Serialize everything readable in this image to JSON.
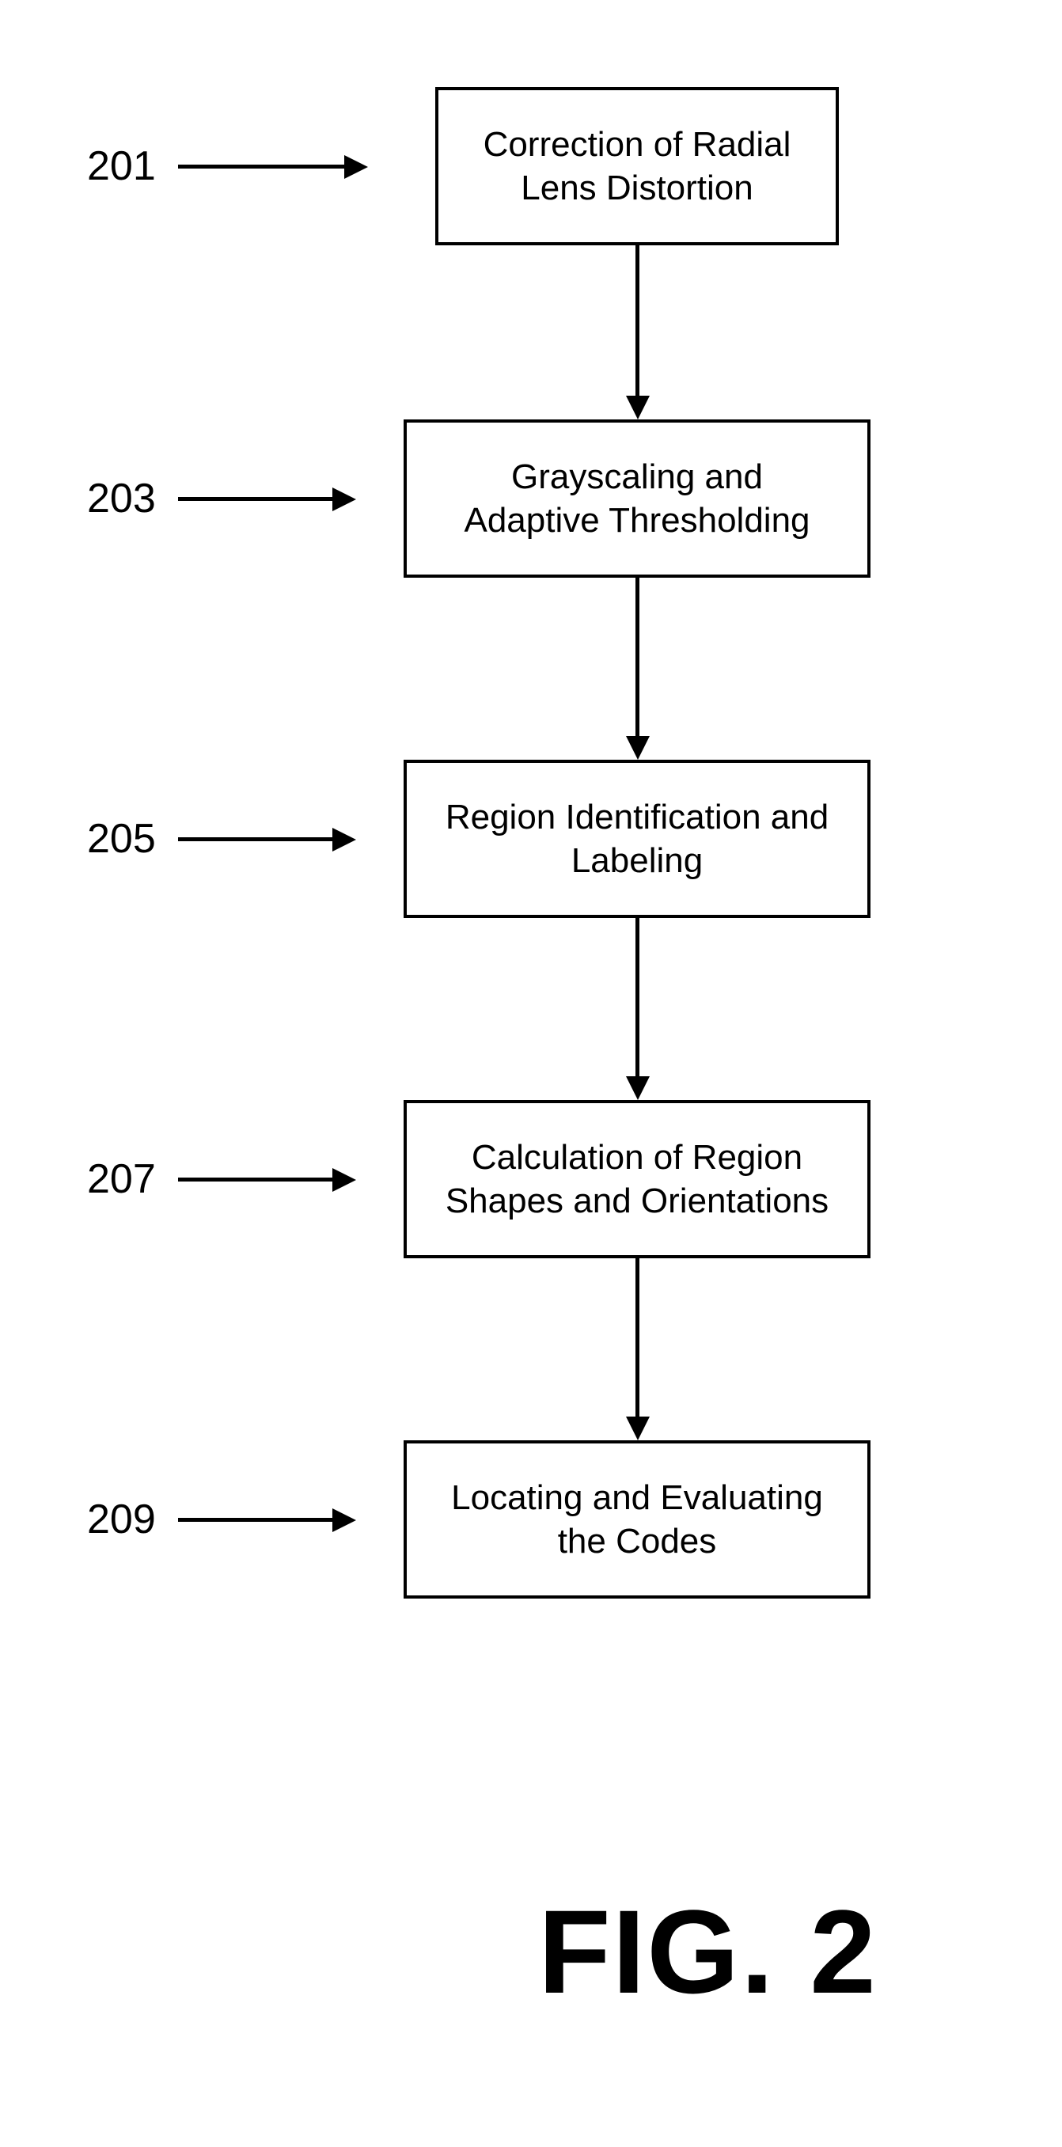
{
  "chart_data": {
    "type": "flowchart",
    "title": "FIG. 2",
    "nodes": [
      {
        "id": "201",
        "label": "Correction of Radial\nLens Distortion"
      },
      {
        "id": "203",
        "label": "Grayscaling and\nAdaptive Thresholding"
      },
      {
        "id": "205",
        "label": "Region Identification and\nLabeling"
      },
      {
        "id": "207",
        "label": "Calculation of Region\nShapes and Orientations"
      },
      {
        "id": "209",
        "label": "Locating and Evaluating\nthe Codes"
      }
    ],
    "edges": [
      {
        "from": "201",
        "to": "203"
      },
      {
        "from": "203",
        "to": "205"
      },
      {
        "from": "205",
        "to": "207"
      },
      {
        "from": "207",
        "to": "209"
      }
    ]
  },
  "labels": {
    "n201": "201",
    "n203": "203",
    "n205": "205",
    "n207": "207",
    "n209": "209"
  },
  "boxes": {
    "b201_l1": "Correction of Radial",
    "b201_l2": "Lens Distortion",
    "b203_l1": "Grayscaling and",
    "b203_l2": "Adaptive Thresholding",
    "b205_l1": "Region Identification and",
    "b205_l2": "Labeling",
    "b207_l1": "Calculation of Region",
    "b207_l2": "Shapes and Orientations",
    "b209_l1": "Locating and Evaluating",
    "b209_l2": "the Codes"
  },
  "caption": "FIG. 2"
}
